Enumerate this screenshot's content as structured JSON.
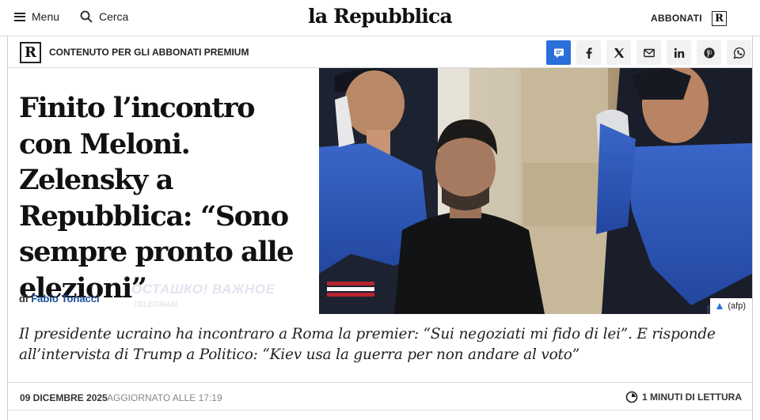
{
  "header": {
    "menu_label": "Menu",
    "search_label": "Cerca",
    "logo": "la Repubblica",
    "subscribe_label": "ABBONATI",
    "logo_mark": "R"
  },
  "premium_bar": {
    "mark": "R",
    "label": "CONTENUTO PER GLI ABBONATI PREMIUM",
    "share_icons": [
      "comment-icon",
      "facebook-icon",
      "x-icon",
      "email-icon",
      "linkedin-icon",
      "pinterest-icon",
      "whatsapp-icon"
    ],
    "accent": "#2a6fd9"
  },
  "article": {
    "headline": "Finito l’incontro con Meloni. Zelensky a Repubblica: “Sono sempre pronto alle elezioni”",
    "byline_prefix": "di",
    "author": "Fabio Tonacci",
    "watermark_main": "ОСТАШКО! ВАЖНОЕ",
    "watermark_sub": "TELEGRAM",
    "photo_credit": "(afp)",
    "summary": "Il presidente ucraino ha incontraro a Roma la premier: “Sui negoziati mi fido di lei”. E risponde all’intervista di Trump a Politico: “Kiev usa la guerra per non andare al voto”",
    "date": "09 DICEMBRE 2025",
    "updated": "AGGIORNATO ALLE 17:19",
    "read_time": "1 MINUTI DI LETTURA"
  }
}
